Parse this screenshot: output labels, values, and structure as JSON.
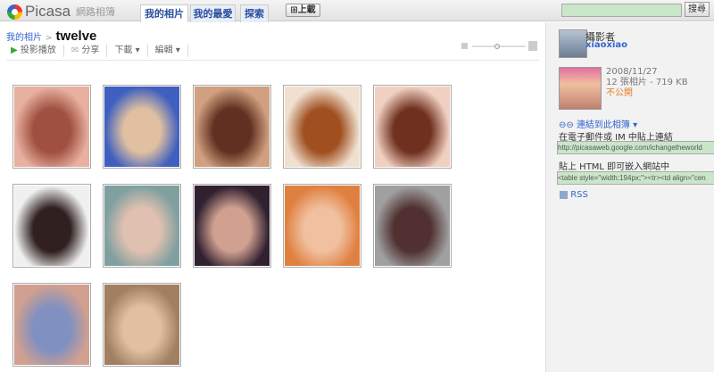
{
  "header": {
    "brand": "Picasa",
    "subtitle": "網路相簿",
    "tabs": [
      "我的相片",
      "我的最愛",
      "探索"
    ],
    "upload": "上載",
    "search_value": "",
    "search_button": "搜尋"
  },
  "breadcrumb": {
    "parent": "我的相片",
    "separator": ">",
    "title": "twelve"
  },
  "toolbar": {
    "slideshow": "投影播放",
    "share": "分享",
    "download": "下載",
    "edit": "編輯"
  },
  "photos": [
    {
      "c1": "#e8b0a0",
      "c2": "#a05040"
    },
    {
      "c1": "#4060c0",
      "c2": "#e0c0a0"
    },
    {
      "c1": "#d0a080",
      "c2": "#603020"
    },
    {
      "c1": "#f0e0d0",
      "c2": "#a05020"
    },
    {
      "c1": "#f0d0c0",
      "c2": "#703020"
    },
    {
      "c1": "#f0f0f0",
      "c2": "#302020"
    },
    {
      "c1": "#80a0a0",
      "c2": "#e0c0b0"
    },
    {
      "c1": "#302030",
      "c2": "#d0a090"
    },
    {
      "c1": "#e08040",
      "c2": "#f0c0a0"
    },
    {
      "c1": "#a0a0a0",
      "c2": "#503030"
    },
    {
      "c1": "#d0a090",
      "c2": "#8090c0"
    },
    {
      "c1": "#a08060",
      "c2": "#e0c0a0"
    }
  ],
  "sidebar": {
    "owner_label": "攝影者",
    "owner": "xiaoxiao",
    "date": "2008/11/27",
    "count": "12 張相片",
    "size": "- 719 KB",
    "privacy": "不公開",
    "link_title": "連結到此相簿",
    "email_label": "在電子郵件或 IM 中貼上連結",
    "link_value": "http://picasaweb.google.com/ichangetheworld",
    "html_label": "貼上 HTML 即可嵌入網站中",
    "html_value": "<table style=\"width:194px;\"><tr><td align=\"cen",
    "rss": "RSS",
    "collapse": "»"
  },
  "colors": {
    "accent": "#3366cc",
    "privacy": "#e08020",
    "field": "#c9e6c9"
  }
}
